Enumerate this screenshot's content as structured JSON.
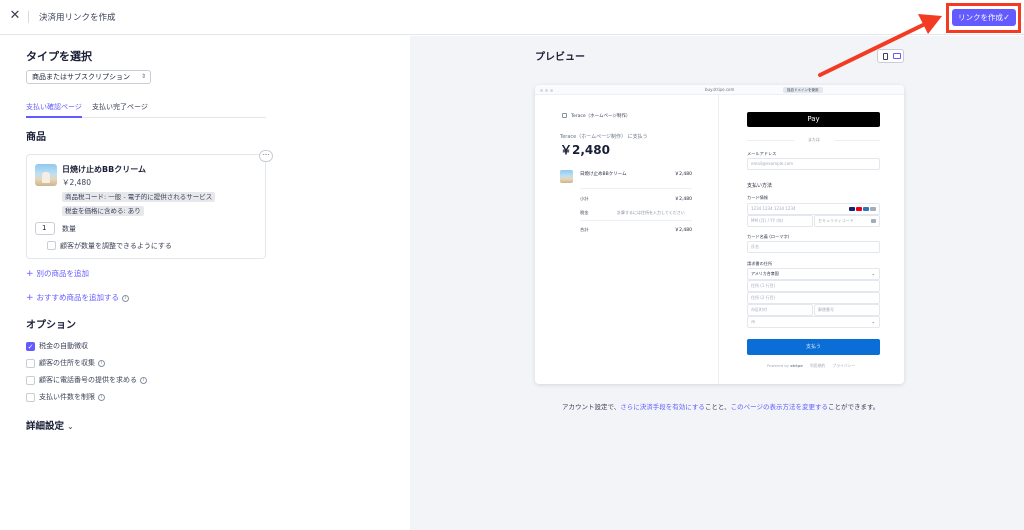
{
  "topbar": {
    "title": "決済用リンクを作成",
    "create_label": "リンクを作成",
    "close_glyph": "✕",
    "check_glyph": "✓"
  },
  "left": {
    "type_heading": "タイプを選択",
    "type_select_value": "商品またはサブスクリプション",
    "tabs": [
      {
        "label": "支払い確認ページ",
        "active": true
      },
      {
        "label": "支払い完了ページ",
        "active": false
      }
    ],
    "products_heading": "商品",
    "product": {
      "name": "日焼け止めBBクリーム",
      "price": "￥2,480",
      "chips": [
        "商品税コード: 一般 - 電子的に提供されるサービス",
        "税金を価格に含める: あり"
      ],
      "quantity": "1",
      "quantity_label": "数量",
      "adjustable_label": "顧客が数量を調整できるようにする"
    },
    "add_product": "別の商品を追加",
    "add_recommended": "おすすめ商品を追加する",
    "options_heading": "オプション",
    "options": [
      {
        "label": "税金の自動徴収",
        "checked": true,
        "info": false
      },
      {
        "label": "顧客の住所を収集",
        "checked": false,
        "info": true
      },
      {
        "label": "顧客に電話番号の提供を求める",
        "checked": false,
        "info": true
      },
      {
        "label": "支払い件数を制限",
        "checked": false,
        "info": true
      }
    ],
    "details_heading": "詳細設定"
  },
  "preview": {
    "heading": "プレビュー",
    "url": "buy.stripe.com",
    "test_badge": "独自ドメインを使用",
    "merchant": "Terace（ホームページ制作）",
    "pay_to": "Terace（ホームページ制作） に支払う",
    "total": "￥2,480",
    "item_name": "日焼け止めBBクリーム",
    "item_price": "￥2,480",
    "subtotal_label": "小計",
    "subtotal": "￥2,480",
    "tax_label": "税金",
    "tax_note": "計算するには住所を入力してください",
    "total_label": "合計",
    "total_value": "￥2,480",
    "applepay": " Pay",
    "or_text": "または",
    "email_label": "メールアドレス",
    "email_placeholder": "email@example.com",
    "payment_heading": "支払い方法",
    "card_label": "カード情報",
    "card_placeholder": "1234 1234 1234 1234",
    "expiry_placeholder": "MM (月) / YY (年)",
    "cvc_placeholder": "セキュリティコード",
    "name_label": "カード名義 (ローマ字)",
    "name_placeholder": "氏名",
    "address_label": "請求書の住所",
    "country_value": "アメリカ合衆国",
    "address1": "住所 (1 行目)",
    "address2": "住所 (2 行目)",
    "city": "市区町村",
    "zip": "郵便番号",
    "state": "州",
    "pay_button": "支払う",
    "powered_by": "Powered by",
    "stripe": "stripe",
    "terms": "利用規約",
    "privacy": "プライバシー"
  },
  "footnote": {
    "pre": "アカウント設定で、",
    "link1": "さらに決済手段を有効にする",
    "mid": "ことと、",
    "link2": "このページの表示方法を変更する",
    "post": "ことができます。"
  },
  "colors": {
    "accent": "#635bff",
    "annotation": "#f23b22",
    "pay_blue": "#0a6ed6"
  }
}
